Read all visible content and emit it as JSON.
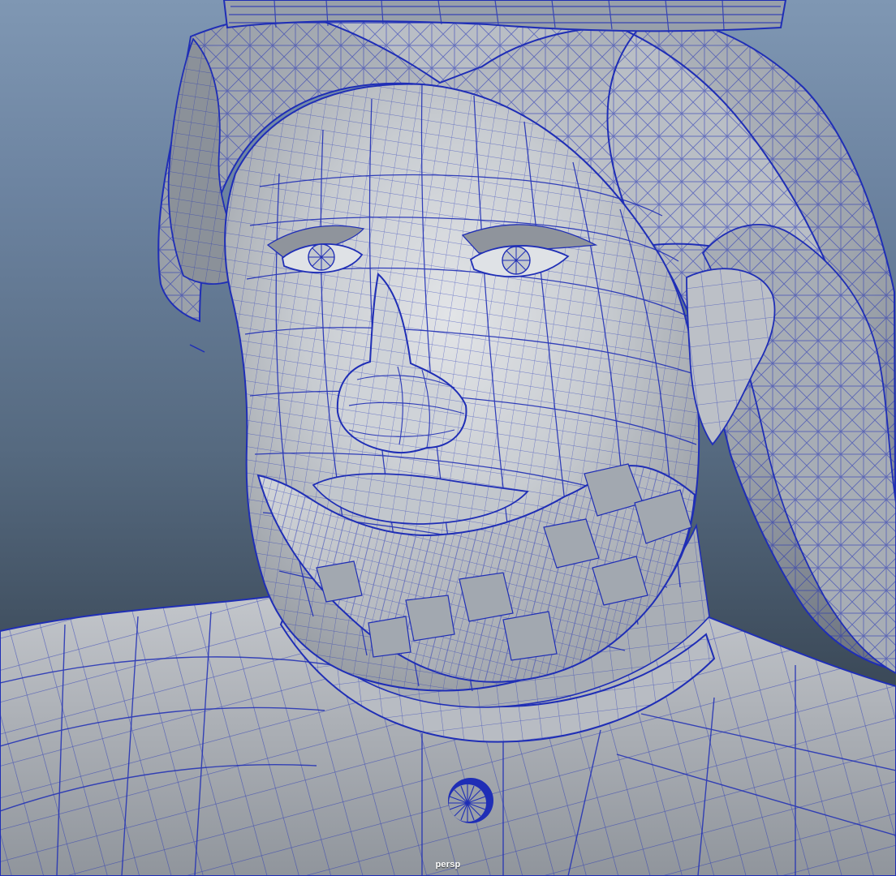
{
  "viewport": {
    "camera_label": "persp",
    "wire_color": "#1f2eb6"
  }
}
